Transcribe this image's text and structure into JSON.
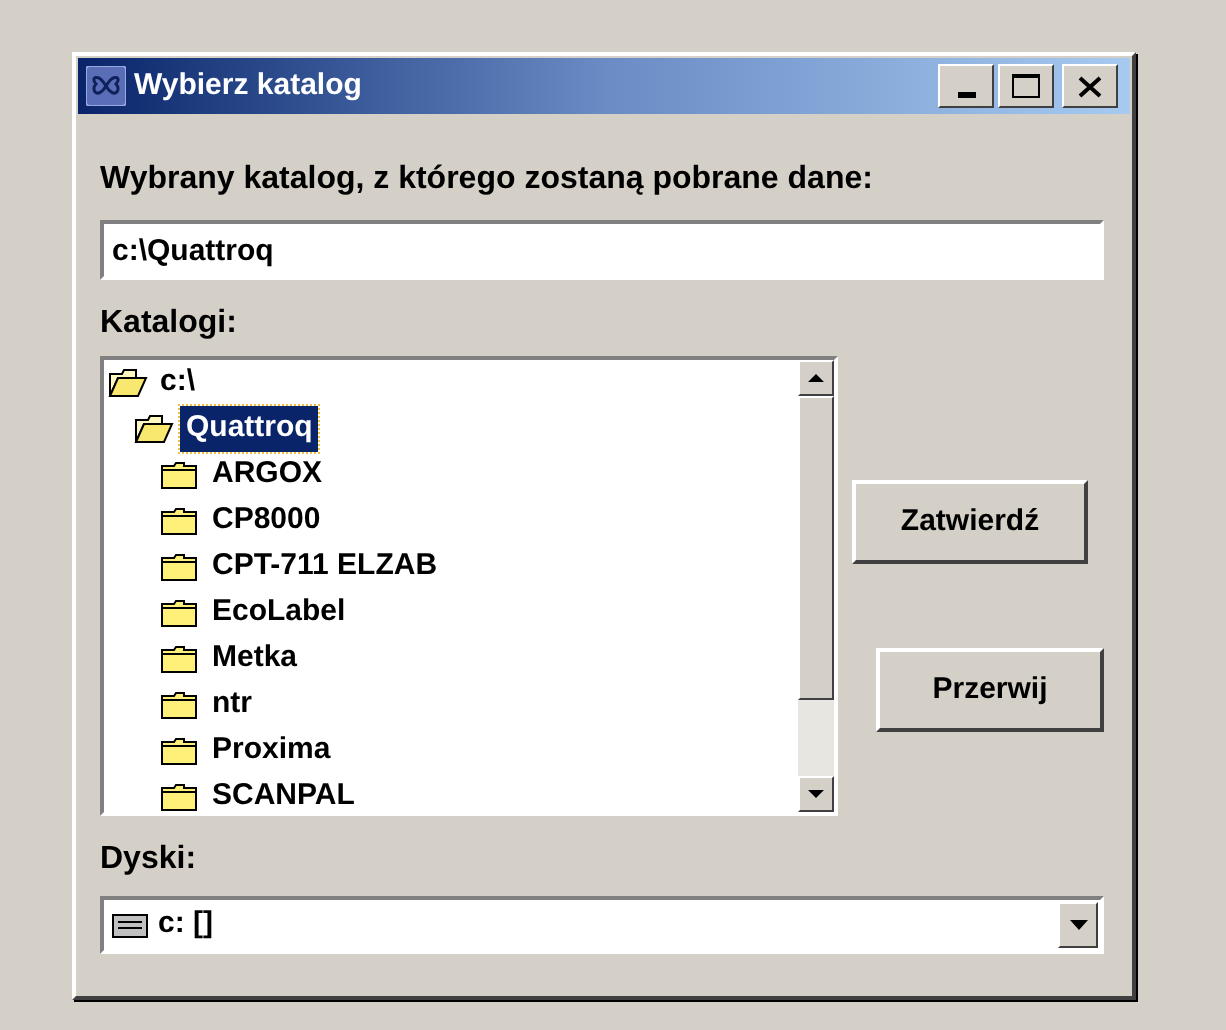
{
  "window": {
    "title": "Wybierz katalog"
  },
  "selected_label": "Wybrany katalog, z którego zostaną pobrane dane:",
  "path_field": {
    "value": "c:\\Quattroq"
  },
  "folders_label": "Katalogi:",
  "folders": [
    {
      "name": "c:\\",
      "expanded": true,
      "selected": false,
      "children": [
        {
          "name": "Quattroq",
          "expanded": true,
          "selected": true,
          "children": [
            {
              "name": "ARGOX",
              "expanded": false,
              "selected": false
            },
            {
              "name": "CP8000",
              "expanded": false,
              "selected": false
            },
            {
              "name": "CPT-711 ELZAB",
              "expanded": false,
              "selected": false
            },
            {
              "name": "EcoLabel",
              "expanded": false,
              "selected": false
            },
            {
              "name": "Metka",
              "expanded": false,
              "selected": false
            },
            {
              "name": "ntr",
              "expanded": false,
              "selected": false
            },
            {
              "name": "Proxima",
              "expanded": false,
              "selected": false
            },
            {
              "name": "SCANPAL",
              "expanded": false,
              "selected": false
            }
          ]
        }
      ]
    }
  ],
  "buttons": [
    "Zatwierdź",
    "Przerwij"
  ],
  "drives_label": "Dyski:",
  "drive_combo": {
    "value": "c: []"
  }
}
